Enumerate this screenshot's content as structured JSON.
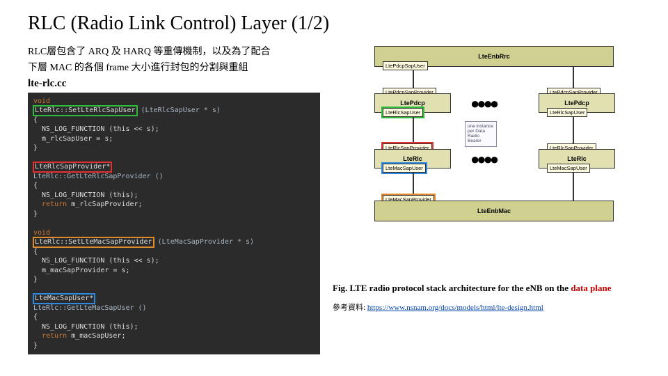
{
  "title": "RLC (Radio Link Control) Layer (1/2)",
  "description_line1": "RLC層包含了 ARQ 及 HARQ 等重傳機制，以及為了配合",
  "description_line2": "下層 MAC 的各個 frame 大小進行封包的分割與重組",
  "filename": "lte-rlc.cc",
  "code": {
    "fn1_decl": "LteRlc::SetLteRlcSapUser",
    "fn1_sig": "(LteRlcSapUser * s)",
    "fn1_body1": "  NS_LOG_FUNCTION (this << s);",
    "fn1_body2": "  m_rlcSapUser = s;",
    "fn2_ret": "LteRlcSapProvider*",
    "fn2_decl": "LteRlc::GetLteRlcSapProvider ()",
    "fn2_body1": "  NS_LOG_FUNCTION (this);",
    "fn2_body2_kw": "return",
    "fn2_body2": " m_rlcSapProvider;",
    "fn3_decl": "LteRlc::SetLteMacSapProvider",
    "fn3_sig": "(LteMacSapProvider * s)",
    "fn3_body1": "  NS_LOG_FUNCTION (this << s);",
    "fn3_body2": "  m_macSapProvider = s;",
    "fn4_ret": "LteMacSapUser*",
    "fn4_decl": "LteRlc::GetLteMacSapUser ()",
    "fn4_body1": "  NS_LOG_FUNCTION (this);",
    "fn4_body2_kw": "return",
    "fn4_body2": " m_macSapUser;"
  },
  "diagram": {
    "enb_rrc": "LteEnbRrc",
    "pdcp_sap_user": "LtePdcpSapUser",
    "pdcp_sap_provider_l": "LtePdcpSapProvider",
    "pdcp_sap_provider_r": "LtePdcpSapProvider",
    "pdcp_l": "LtePdcp",
    "pdcp_r": "LtePdcp",
    "rlc_sap_user_l": "LteRlcSapUser",
    "rlc_sap_user_r": "LteRlcSapUser",
    "rlc_sap_provider_l": "LteRlcSapProvider",
    "rlc_sap_provider_r": "LteRlcSapProvider",
    "rlc_l": "LteRlc",
    "rlc_r": "LteRlc",
    "mac_sap_user_l": "LteMacSapUser",
    "mac_sap_user_r": "LteMacSapUser",
    "mac_sap_provider": "LteMacSapProvider",
    "enb_mac": "LteEnbMac",
    "note_text": "one instance per Data Radio Bearer",
    "dots": "●●●●"
  },
  "fig_caption_pre": "Fig. LTE radio protocol stack architecture for the eNB on the ",
  "fig_caption_dp": "data plane",
  "reference_label": "參考資料: ",
  "reference_url": "https://www.nsnam.org/docs/models/html/lte-design.html"
}
